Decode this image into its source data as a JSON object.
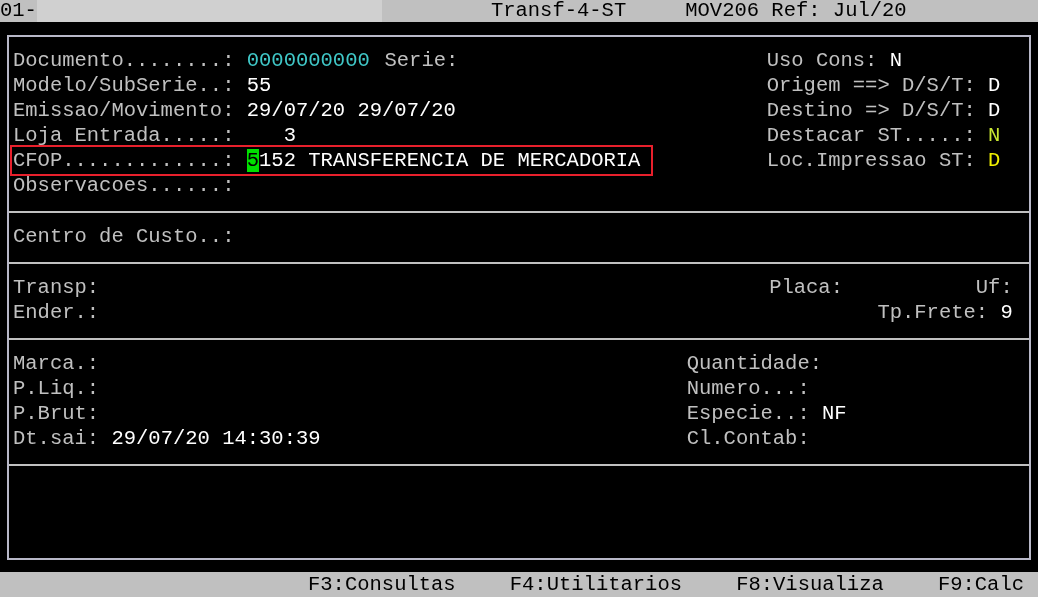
{
  "title_bar": {
    "left": "01-",
    "title": "Transf-4-ST",
    "ref": "MOV206 Ref: Jul/20"
  },
  "sections": [
    {
      "kind": "document",
      "rows": [
        {
          "highlighted": false,
          "left": [
            {
              "label": "Documento........:",
              "value": "0000000000",
              "color": "#40c8c8"
            },
            {
              "label": "Serie:"
            }
          ],
          "right": [
            {
              "label": "Uso Cons:",
              "value": "N",
              "color": "#ffffff"
            }
          ]
        },
        {
          "highlighted": false,
          "left": [
            {
              "label": "Modelo/SubSerie..:",
              "value": "55",
              "color": "#ffffff"
            }
          ],
          "right": [
            {
              "label": "Origem ==> D/S/T:",
              "value": "D",
              "color": "#ffffff"
            }
          ]
        },
        {
          "highlighted": false,
          "left": [
            {
              "label": "Emissao/Movimento:",
              "value": "29/07/20 29/07/20",
              "color": "#ffffff"
            }
          ],
          "right": [
            {
              "label": "Destino => D/S/T:",
              "value": "D",
              "color": "#ffffff"
            }
          ]
        },
        {
          "highlighted": false,
          "left": [
            {
              "label": "Loja Entrada.....:",
              "value": "3",
              "color": "#ffffff",
              "kind": "numeric"
            }
          ],
          "right": [
            {
              "label": "Destacar ST.....:",
              "value": "N",
              "color": "#c8e632"
            }
          ]
        },
        {
          "highlighted": true,
          "left": [
            {
              "label": "CFOP.............:",
              "value": "5152 TRANSFERENCIA DE MERCADORIA",
              "color": "#ffffff",
              "cursor": true
            }
          ],
          "right": [
            {
              "label": "Loc.Impressao ST:",
              "value": "D",
              "color": "#f0f000"
            }
          ]
        },
        {
          "highlighted": false,
          "left": [
            {
              "label": "Observacoes......:"
            }
          ],
          "right": []
        }
      ]
    },
    {
      "kind": "cost",
      "rows": [
        {
          "highlighted": false,
          "left": [
            {
              "label": "Centro de Custo..:"
            }
          ],
          "right": []
        }
      ]
    },
    {
      "kind": "transport",
      "rows": [
        {
          "highlighted": false,
          "left": [
            {
              "label": "Transp:"
            }
          ],
          "right": [
            {
              "label": "Placa:"
            },
            {
              "label": "Uf:"
            }
          ]
        },
        {
          "highlighted": false,
          "left": [
            {
              "label": "Ender.:"
            }
          ],
          "right": [
            {
              "label": "Tp.Frete:",
              "value": "9",
              "color": "#ffffff"
            }
          ]
        }
      ]
    },
    {
      "kind": "volumes",
      "rows": [
        {
          "highlighted": false,
          "left": [
            {
              "label": "Marca.:"
            }
          ],
          "right": [
            {
              "label": "Quantidade:"
            }
          ]
        },
        {
          "highlighted": false,
          "left": [
            {
              "label": "P.Liq.:"
            }
          ],
          "right": [
            {
              "label": "Numero...:"
            }
          ]
        },
        {
          "highlighted": false,
          "left": [
            {
              "label": "P.Brut:"
            }
          ],
          "right": [
            {
              "label": "Especie..:",
              "value": "NF",
              "color": "#ffffff"
            }
          ]
        },
        {
          "highlighted": false,
          "left": [
            {
              "label": "Dt.sai:",
              "value": "29/07/20 14:30:39",
              "color": "#ffffff"
            }
          ],
          "right": [
            {
              "label": "Cl.Contab:"
            }
          ]
        }
      ]
    },
    {
      "kind": "blank"
    }
  ],
  "function_keys": [
    "F3:Consultas",
    "F4:Utilitarios",
    "F8:Visualiza",
    "F9:Calc"
  ]
}
